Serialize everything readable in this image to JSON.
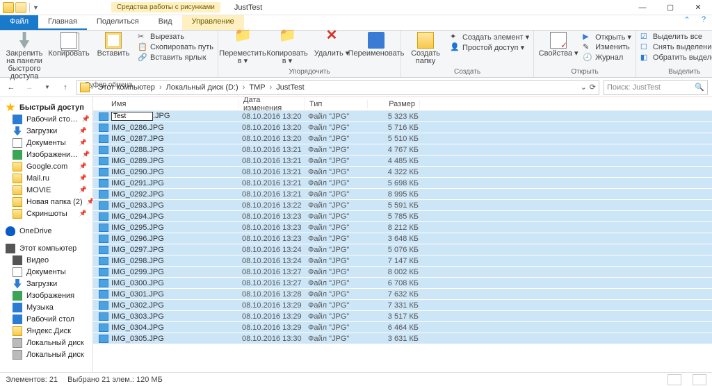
{
  "window": {
    "title": "JustTest",
    "context_tab": "Средства работы с рисунками"
  },
  "tabs": {
    "file": "Файл",
    "home": "Главная",
    "share": "Поделиться",
    "view": "Вид",
    "ctx": "Управление"
  },
  "ribbon": {
    "clipboard": {
      "label": "Буфер обмена",
      "pin": "Закрепить на панели\nбыстрого доступа",
      "copy": "Копировать",
      "paste": "Вставить",
      "cut": "Вырезать",
      "copypath": "Скопировать путь",
      "pastelink": "Вставить ярлык"
    },
    "organize": {
      "label": "Упорядочить",
      "move": "Переместить\nв ▾",
      "copyto": "Копировать\nв ▾",
      "delete": "Удалить\n▾",
      "rename": "Переименовать"
    },
    "new": {
      "label": "Создать",
      "folder": "Создать\nпапку",
      "newitem": "Создать элемент ▾",
      "easy": "Простой доступ ▾"
    },
    "open": {
      "label": "Открыть",
      "props": "Свойства\n▾",
      "open": "Открыть ▾",
      "edit": "Изменить",
      "history": "Журнал"
    },
    "select": {
      "label": "Выделить",
      "all": "Выделить все",
      "none": "Снять выделение",
      "invert": "Обратить выделение"
    }
  },
  "breadcrumb": [
    "Этот компьютер",
    "Локальный диск (D:)",
    "TMP",
    "JustTest"
  ],
  "search_placeholder": "Поиск: JustTest",
  "nav": {
    "quick": {
      "head": "Быстрый доступ",
      "items": [
        "Рабочий сто…",
        "Загрузки",
        "Документы",
        "Изображени…",
        "Google.com",
        "Mail.ru",
        "MOVIE",
        "Новая папка (2)",
        "Скриншоты"
      ]
    },
    "onedrive": "OneDrive",
    "thispc": {
      "head": "Этот компьютер",
      "items": [
        "Видео",
        "Документы",
        "Загрузки",
        "Изображения",
        "Музыка",
        "Рабочий стол",
        "Яндекс.Диск",
        "Локальный диск",
        "Локальный диск"
      ]
    }
  },
  "columns": {
    "name": "Имя",
    "date": "Дата изменения",
    "type": "Тип",
    "size": "Размер"
  },
  "rename_value": "Test",
  "files": [
    {
      "name": "Test.JPG",
      "renaming": true,
      "date": "08.10.2016 13:20",
      "type": "Файл \"JPG\"",
      "size": "5 323 КБ"
    },
    {
      "name": "IMG_0286.JPG",
      "date": "08.10.2016 13:20",
      "type": "Файл \"JPG\"",
      "size": "5 716 КБ"
    },
    {
      "name": "IMG_0287.JPG",
      "date": "08.10.2016 13:20",
      "type": "Файл \"JPG\"",
      "size": "5 510 КБ"
    },
    {
      "name": "IMG_0288.JPG",
      "date": "08.10.2016 13:21",
      "type": "Файл \"JPG\"",
      "size": "4 767 КБ"
    },
    {
      "name": "IMG_0289.JPG",
      "date": "08.10.2016 13:21",
      "type": "Файл \"JPG\"",
      "size": "4 485 КБ"
    },
    {
      "name": "IMG_0290.JPG",
      "date": "08.10.2016 13:21",
      "type": "Файл \"JPG\"",
      "size": "4 322 КБ"
    },
    {
      "name": "IMG_0291.JPG",
      "date": "08.10.2016 13:21",
      "type": "Файл \"JPG\"",
      "size": "5 698 КБ"
    },
    {
      "name": "IMG_0292.JPG",
      "date": "08.10.2016 13:21",
      "type": "Файл \"JPG\"",
      "size": "8 995 КБ"
    },
    {
      "name": "IMG_0293.JPG",
      "date": "08.10.2016 13:22",
      "type": "Файл \"JPG\"",
      "size": "5 591 КБ"
    },
    {
      "name": "IMG_0294.JPG",
      "date": "08.10.2016 13:23",
      "type": "Файл \"JPG\"",
      "size": "5 785 КБ"
    },
    {
      "name": "IMG_0295.JPG",
      "date": "08.10.2016 13:23",
      "type": "Файл \"JPG\"",
      "size": "8 212 КБ"
    },
    {
      "name": "IMG_0296.JPG",
      "date": "08.10.2016 13:23",
      "type": "Файл \"JPG\"",
      "size": "3 648 КБ"
    },
    {
      "name": "IMG_0297.JPG",
      "date": "08.10.2016 13:24",
      "type": "Файл \"JPG\"",
      "size": "5 076 КБ"
    },
    {
      "name": "IMG_0298.JPG",
      "date": "08.10.2016 13:24",
      "type": "Файл \"JPG\"",
      "size": "7 147 КБ"
    },
    {
      "name": "IMG_0299.JPG",
      "date": "08.10.2016 13:27",
      "type": "Файл \"JPG\"",
      "size": "8 002 КБ"
    },
    {
      "name": "IMG_0300.JPG",
      "date": "08.10.2016 13:27",
      "type": "Файл \"JPG\"",
      "size": "6 708 КБ"
    },
    {
      "name": "IMG_0301.JPG",
      "date": "08.10.2016 13:28",
      "type": "Файл \"JPG\"",
      "size": "7 632 КБ"
    },
    {
      "name": "IMG_0302.JPG",
      "date": "08.10.2016 13:29",
      "type": "Файл \"JPG\"",
      "size": "7 331 КБ"
    },
    {
      "name": "IMG_0303.JPG",
      "date": "08.10.2016 13:29",
      "type": "Файл \"JPG\"",
      "size": "3 517 КБ"
    },
    {
      "name": "IMG_0304.JPG",
      "date": "08.10.2016 13:29",
      "type": "Файл \"JPG\"",
      "size": "6 464 КБ"
    },
    {
      "name": "IMG_0305.JPG",
      "date": "08.10.2016 13:30",
      "type": "Файл \"JPG\"",
      "size": "3 631 КБ"
    }
  ],
  "status": {
    "count": "Элементов: 21",
    "selection": "Выбрано 21 элем.: 120 МБ"
  }
}
